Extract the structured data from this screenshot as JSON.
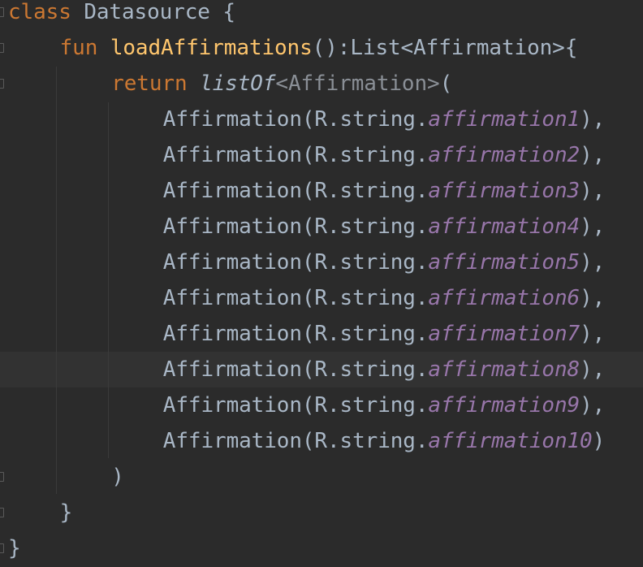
{
  "editor": {
    "lines": [
      {
        "parts": [
          [
            "kw",
            "class "
          ],
          [
            "",
            "Datasource {"
          ]
        ],
        "indent": 0
      },
      {
        "parts": [
          [
            "kw",
            "fun "
          ],
          [
            "fn",
            "loadAffirmations"
          ],
          [
            "",
            "():List<Affirmation>{"
          ]
        ],
        "indent": 1
      },
      {
        "parts": [
          [
            "kw",
            "return "
          ],
          [
            "ext",
            "listOf"
          ],
          [
            "gen",
            "<Affirmation>"
          ],
          [
            "",
            "("
          ]
        ],
        "indent": 2
      },
      {
        "parts": [
          [
            "",
            "Affirmation(R.string."
          ],
          [
            "prop",
            "affirmation1"
          ],
          [
            "",
            "),"
          ]
        ],
        "indent": 3
      },
      {
        "parts": [
          [
            "",
            "Affirmation(R.string."
          ],
          [
            "prop",
            "affirmation2"
          ],
          [
            "",
            "),"
          ]
        ],
        "indent": 3
      },
      {
        "parts": [
          [
            "",
            "Affirmation(R.string."
          ],
          [
            "prop",
            "affirmation3"
          ],
          [
            "",
            "),"
          ]
        ],
        "indent": 3
      },
      {
        "parts": [
          [
            "",
            "Affirmation(R.string."
          ],
          [
            "prop",
            "affirmation4"
          ],
          [
            "",
            "),"
          ]
        ],
        "indent": 3
      },
      {
        "parts": [
          [
            "",
            "Affirmation(R.string."
          ],
          [
            "prop",
            "affirmation5"
          ],
          [
            "",
            "),"
          ]
        ],
        "indent": 3
      },
      {
        "parts": [
          [
            "",
            "Affirmation(R.string."
          ],
          [
            "prop",
            "affirmation6"
          ],
          [
            "",
            "),"
          ]
        ],
        "indent": 3
      },
      {
        "parts": [
          [
            "",
            "Affirmation(R.string."
          ],
          [
            "prop",
            "affirmation7"
          ],
          [
            "",
            "),"
          ]
        ],
        "indent": 3
      },
      {
        "parts": [
          [
            "",
            "Affirmation(R.string."
          ],
          [
            "prop",
            "affirmation8"
          ],
          [
            "",
            "),"
          ]
        ],
        "indent": 3,
        "highlighted": true
      },
      {
        "parts": [
          [
            "",
            "Affirmation(R.string."
          ],
          [
            "prop",
            "affirmation9"
          ],
          [
            "",
            "),"
          ]
        ],
        "indent": 3
      },
      {
        "parts": [
          [
            "",
            "Affirmation(R.string."
          ],
          [
            "prop",
            "affirmation10"
          ],
          [
            "",
            ")"
          ]
        ],
        "indent": 3
      },
      {
        "parts": [
          [
            "",
            ")"
          ]
        ],
        "indent": 2
      },
      {
        "parts": [
          [
            "",
            "}"
          ]
        ],
        "indent": 1
      },
      {
        "parts": [
          [
            "",
            "}"
          ]
        ],
        "indent": 0
      }
    ],
    "fold_markers_on_lines": [
      0,
      1,
      2,
      13,
      14,
      15
    ]
  },
  "colors": {
    "background": "#2b2b2b",
    "keyword": "#cc7832",
    "function": "#ffc66d",
    "text": "#a9b7c6",
    "property": "#9876aa"
  }
}
